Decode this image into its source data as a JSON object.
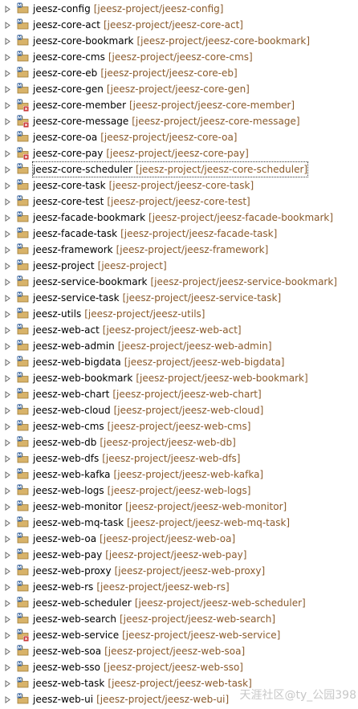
{
  "colors": {
    "name_text": "#000000",
    "path_text": "#8a5a2b",
    "twisty": "#6b6b6b",
    "folder_icon": "#d8b36a",
    "badge_maven": "#1d4f91",
    "badge_error": "#c62828"
  },
  "projects": [
    {
      "name": "jeesz-config",
      "path": "[jeesz-project/jeesz-config]",
      "badge": "m"
    },
    {
      "name": "jeesz-core-act",
      "path": "[jeesz-project/jeesz-core-act]",
      "badge": "m"
    },
    {
      "name": "jeesz-core-bookmark",
      "path": "[jeesz-project/jeesz-core-bookmark]",
      "badge": "m"
    },
    {
      "name": "jeesz-core-cms",
      "path": "[jeesz-project/jeesz-core-cms]",
      "badge": "m"
    },
    {
      "name": "jeesz-core-eb",
      "path": "[jeesz-project/jeesz-core-eb]",
      "badge": "m"
    },
    {
      "name": "jeesz-core-gen",
      "path": "[jeesz-project/jeesz-core-gen]",
      "badge": "m"
    },
    {
      "name": "jeesz-core-member",
      "path": "[jeesz-project/jeesz-core-member]",
      "badge": "m-error"
    },
    {
      "name": "jeesz-core-message",
      "path": "[jeesz-project/jeesz-core-message]",
      "badge": "m-error"
    },
    {
      "name": "jeesz-core-oa",
      "path": "[jeesz-project/jeesz-core-oa]",
      "badge": "m"
    },
    {
      "name": "jeesz-core-pay",
      "path": "[jeesz-project/jeesz-core-pay]",
      "badge": "m-error"
    },
    {
      "name": "jeesz-core-scheduler",
      "path": "[jeesz-project/jeesz-core-scheduler]",
      "badge": "m",
      "selected": true
    },
    {
      "name": "jeesz-core-task",
      "path": "[jeesz-project/jeesz-core-task]",
      "badge": "m"
    },
    {
      "name": "jeesz-core-test",
      "path": "[jeesz-project/jeesz-core-test]",
      "badge": "m"
    },
    {
      "name": "jeesz-facade-bookmark",
      "path": "[jeesz-project/jeesz-facade-bookmark]",
      "badge": "m"
    },
    {
      "name": "jeesz-facade-task",
      "path": "[jeesz-project/jeesz-facade-task]",
      "badge": "m"
    },
    {
      "name": "jeesz-framework",
      "path": "[jeesz-project/jeesz-framework]",
      "badge": "m"
    },
    {
      "name": "jeesz-project",
      "path": "[jeesz-project]",
      "badge": "m"
    },
    {
      "name": "jeesz-service-bookmark",
      "path": "[jeesz-project/jeesz-service-bookmark]",
      "badge": "m"
    },
    {
      "name": "jeesz-service-task",
      "path": "[jeesz-project/jeesz-service-task]",
      "badge": "m"
    },
    {
      "name": "jeesz-utils",
      "path": "[jeesz-project/jeesz-utils]",
      "badge": "m"
    },
    {
      "name": "jeesz-web-act",
      "path": "[jeesz-project/jeesz-web-act]",
      "badge": "m"
    },
    {
      "name": "jeesz-web-admin",
      "path": "[jeesz-project/jeesz-web-admin]",
      "badge": "m"
    },
    {
      "name": "jeesz-web-bigdata",
      "path": "[jeesz-project/jeesz-web-bigdata]",
      "badge": "m"
    },
    {
      "name": "jeesz-web-bookmark",
      "path": "[jeesz-project/jeesz-web-bookmark]",
      "badge": "m"
    },
    {
      "name": "jeesz-web-chart",
      "path": "[jeesz-project/jeesz-web-chart]",
      "badge": "m"
    },
    {
      "name": "jeesz-web-cloud",
      "path": "[jeesz-project/jeesz-web-cloud]",
      "badge": "m"
    },
    {
      "name": "jeesz-web-cms",
      "path": "[jeesz-project/jeesz-web-cms]",
      "badge": "m"
    },
    {
      "name": "jeesz-web-db",
      "path": "[jeesz-project/jeesz-web-db]",
      "badge": "m"
    },
    {
      "name": "jeesz-web-dfs",
      "path": "[jeesz-project/jeesz-web-dfs]",
      "badge": "m"
    },
    {
      "name": "jeesz-web-kafka",
      "path": "[jeesz-project/jeesz-web-kafka]",
      "badge": "m"
    },
    {
      "name": "jeesz-web-logs",
      "path": "[jeesz-project/jeesz-web-logs]",
      "badge": "m"
    },
    {
      "name": "jeesz-web-monitor",
      "path": "[jeesz-project/jeesz-web-monitor]",
      "badge": "m"
    },
    {
      "name": "jeesz-web-mq-task",
      "path": "[jeesz-project/jeesz-web-mq-task]",
      "badge": "m"
    },
    {
      "name": "jeesz-web-oa",
      "path": "[jeesz-project/jeesz-web-oa]",
      "badge": "m"
    },
    {
      "name": "jeesz-web-pay",
      "path": "[jeesz-project/jeesz-web-pay]",
      "badge": "m"
    },
    {
      "name": "jeesz-web-proxy",
      "path": "[jeesz-project/jeesz-web-proxy]",
      "badge": "m"
    },
    {
      "name": "jeesz-web-rs",
      "path": "[jeesz-project/jeesz-web-rs]",
      "badge": "m"
    },
    {
      "name": "jeesz-web-scheduler",
      "path": "[jeesz-project/jeesz-web-scheduler]",
      "badge": "m"
    },
    {
      "name": "jeesz-web-search",
      "path": "[jeesz-project/jeesz-web-search]",
      "badge": "m"
    },
    {
      "name": "jeesz-web-service",
      "path": "[jeesz-project/jeesz-web-service]",
      "badge": "m-error"
    },
    {
      "name": "jeesz-web-soa",
      "path": "[jeesz-project/jeesz-web-soa]",
      "badge": "m"
    },
    {
      "name": "jeesz-web-sso",
      "path": "[jeesz-project/jeesz-web-sso]",
      "badge": "m"
    },
    {
      "name": "jeesz-web-task",
      "path": "[jeesz-project/jeesz-web-task]",
      "badge": "m"
    },
    {
      "name": "jeesz-web-ui",
      "path": "[jeesz-project/jeesz-web-ui]",
      "badge": "m"
    }
  ],
  "watermark": "天涯社区@ty_公园398"
}
